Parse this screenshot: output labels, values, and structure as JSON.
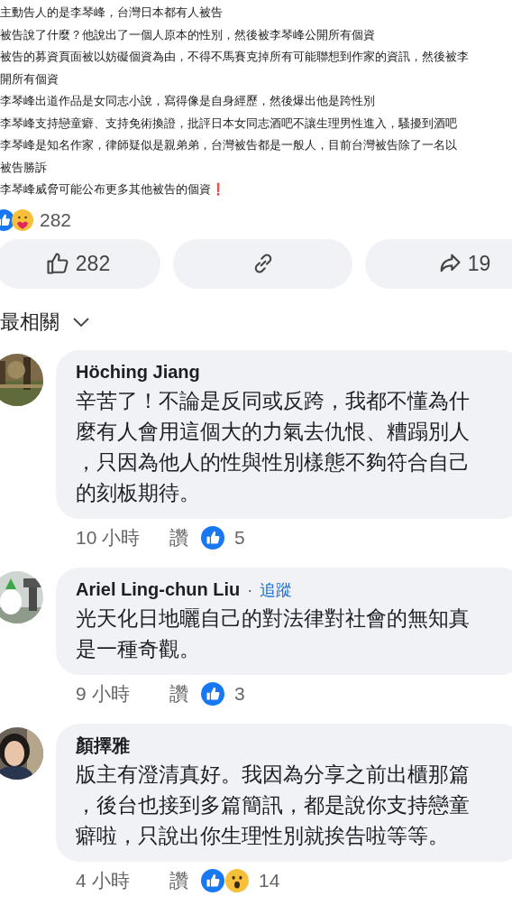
{
  "post_image_text": {
    "lines": [
      "主動告人的是李琴峰，台灣日本都有人被告",
      "被告說了什麼？他說出了一個人原本的性別，然後被李琴峰公開所有個資",
      "被告的募資頁面被以妨礙個資為由，不得不馬賽克掉所有可能聯想到作家的資訊，然後被李",
      "開所有個資",
      "李琴峰出道作品是女同志小說，寫得像是自身經歷，然後爆出他是跨性別",
      "李琴峰支持戀童癖、支持免術換證，批評日本女同志酒吧不讓生理男性進入，騷擾到酒吧",
      "李琴峰是知名作家，律師疑似是親弟弟，台灣被告都是一般人，目前台灣被告除了一名以",
      "被告勝訴",
      "李琴峰威脅可能公布更多其他被告的個資❗"
    ]
  },
  "reactions": {
    "icons": [
      {
        "kind": "like"
      },
      {
        "kind": "care"
      }
    ],
    "count": "282"
  },
  "actions": [
    {
      "kind": "like",
      "count": "282"
    },
    {
      "kind": "link"
    },
    {
      "kind": "share",
      "count": "19"
    }
  ],
  "sort": {
    "label": "最相關"
  },
  "comments": [
    {
      "avatar": {
        "kind": "picture"
      },
      "name": "Höching Jiang",
      "text": "辛苦了！不論是反同或反跨，我都不懂為什麼有人會用這個大的力氣去仇恨、糟蹋別人，只因為他人的性與性別樣態不夠符合自己的刻板期待。",
      "time": "10 小時",
      "like_label": "讚",
      "reaction_icons": [
        {
          "kind": "like"
        }
      ],
      "reaction_count": "5"
    },
    {
      "avatar": {
        "kind": "picture"
      },
      "name": "Ariel Ling-chun Liu",
      "separator": "·",
      "follow": "追蹤",
      "text": "光天化日地曬自己的對法律對社會的無知真是一種奇觀。",
      "time": "9 小時",
      "like_label": "讚",
      "reaction_icons": [
        {
          "kind": "like"
        }
      ],
      "reaction_count": "3"
    },
    {
      "avatar": {
        "kind": "picture"
      },
      "name": "顏擇雅",
      "text": "版主有澄清真好。我因為分享之前出櫃那篇，後台也接到多篇簡訊，都是說你支持戀童癖啦，只說出你生理性別就挨告啦等等。",
      "time": "4 小時",
      "like_label": "讚",
      "reaction_icons": [
        {
          "kind": "like"
        },
        {
          "kind": "wow"
        }
      ],
      "reaction_count": "14"
    }
  ]
}
